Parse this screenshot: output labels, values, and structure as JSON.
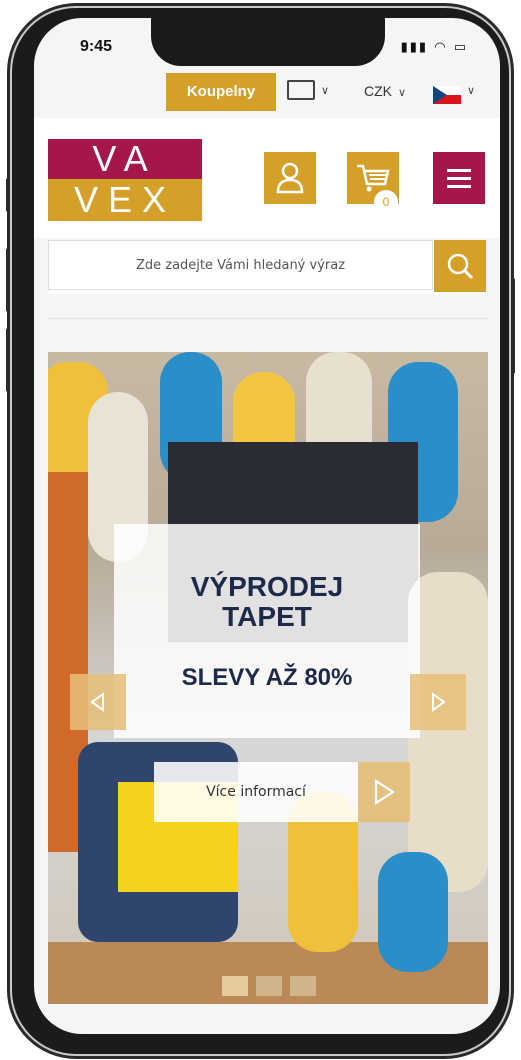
{
  "status_bar": {
    "time": "9:45"
  },
  "topbar": {
    "category_label": "Koupelny",
    "currency": "CZK"
  },
  "header": {
    "logo_top": "VA",
    "logo_bottom": "VEX",
    "cart_count": "0"
  },
  "search": {
    "placeholder": "Zde zadejte Vámi hledaný výraz"
  },
  "hero": {
    "title_line1": "VÝPRODEJ",
    "title_line2": "TAPET",
    "subtitle": "SLEVY AŽ 80%",
    "cta_label": "Více informací",
    "active_slide": 1,
    "slide_count": 3
  },
  "colors": {
    "brand_gold": "#d5a02a",
    "brand_red": "#a5174a",
    "text_dark": "#1e2a4a"
  },
  "icons": [
    "truck-icon",
    "chevron-down-icon",
    "flag-cz-icon",
    "user-icon",
    "cart-icon",
    "menu-icon",
    "search-icon",
    "arrow-left-icon",
    "arrow-right-icon",
    "play-arrow-icon"
  ]
}
